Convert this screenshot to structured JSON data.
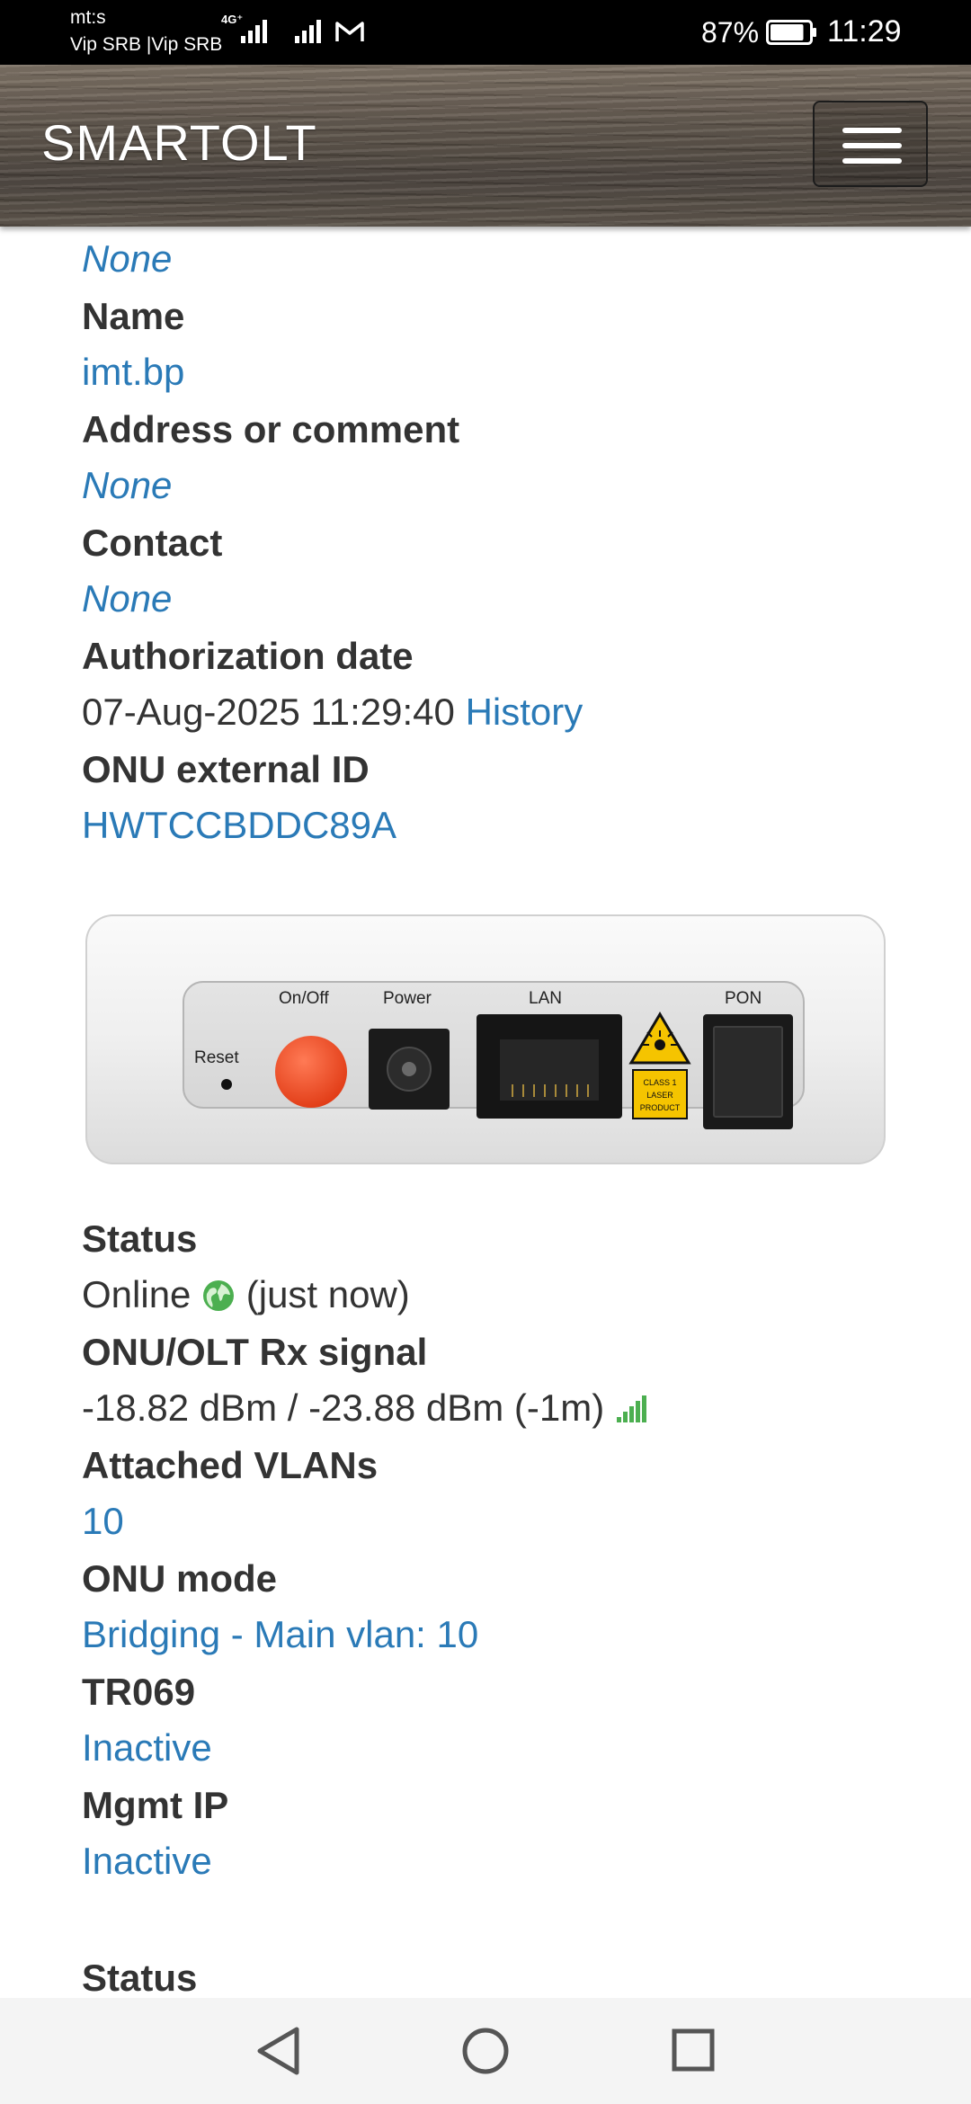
{
  "status_bar": {
    "carrier_top": "mt:s",
    "carrier_bottom": "Vip SRB |Vip SRB",
    "network_type": "4G⁺",
    "battery_percent": "87%",
    "battery_level": 0.87,
    "time": "11:29",
    "icons": [
      "signal-icon",
      "signal-icon",
      "gmail-icon",
      "battery-icon"
    ]
  },
  "header": {
    "brand": "SMARTOLT",
    "menu_icon": "hamburger-icon"
  },
  "details": {
    "top_value": "None",
    "name_label": "Name",
    "name_value": "imt.bp",
    "address_label": "Address or comment",
    "address_value": "None",
    "contact_label": "Contact",
    "contact_value": "None",
    "auth_label": "Authorization date",
    "auth_value": "07-Aug-2025 11:29:40",
    "history_link": "History",
    "ext_id_label": "ONU external ID",
    "ext_id_value": "HWTCCBDDC89A"
  },
  "device": {
    "port_labels": {
      "reset": "Reset",
      "onoff": "On/Off",
      "power": "Power",
      "lan": "LAN",
      "pon": "PON",
      "laser_warning": [
        "CLASS 1",
        "LASER",
        "PRODUCT"
      ]
    }
  },
  "status_section": {
    "status_label": "Status",
    "status_value": "Online",
    "status_time": "(just now)",
    "status_icon": "globe-icon",
    "rx_label": "ONU/OLT Rx signal",
    "rx_value": "-18.82 dBm / -23.88 dBm (-1m)",
    "rx_icon": "signal-strength-icon",
    "vlans_label": "Attached VLANs",
    "vlans_value": "10",
    "mode_label": "ONU mode",
    "mode_value": "Bridging - Main vlan: 10",
    "tr069_label": "TR069",
    "tr069_value": "Inactive",
    "mgmt_label": "Mgmt IP",
    "mgmt_value": "Inactive",
    "bottom_label": "Status"
  },
  "colors": {
    "link": "#2a7ab7",
    "label": "#333333",
    "online_green": "#4caf50"
  },
  "navbar": {
    "icons": [
      "back-icon",
      "home-icon",
      "recents-icon"
    ]
  }
}
